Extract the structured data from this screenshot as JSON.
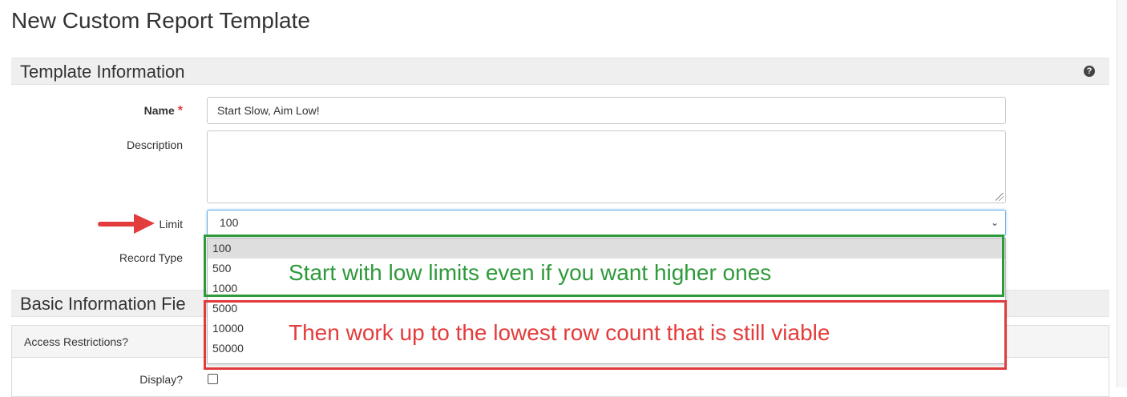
{
  "page_title": "New Custom Report Template",
  "sections": {
    "template_info": "Template Information",
    "basic_info": "Basic Information Fie"
  },
  "icons": {
    "help": "?",
    "required": "*",
    "chevron": "⌄"
  },
  "form": {
    "name_label": "Name",
    "name_value": "Start Slow, Aim Low!",
    "description_label": "Description",
    "description_value": "",
    "limit_label": "Limit",
    "limit_value": "100",
    "record_type_label": "Record Type"
  },
  "limit_options": [
    "100",
    "500",
    "1000",
    "5000",
    "10000",
    "50000"
  ],
  "annotations": {
    "green": "Start with low limits even if you want higher ones",
    "red": "Then work up to the lowest row count that is still viable"
  },
  "panel": {
    "title": "Access Restrictions?",
    "display_label": "Display?"
  },
  "colors": {
    "green": "#2e9a3a",
    "red": "#e33c3c",
    "focus_border": "#66afe9"
  }
}
